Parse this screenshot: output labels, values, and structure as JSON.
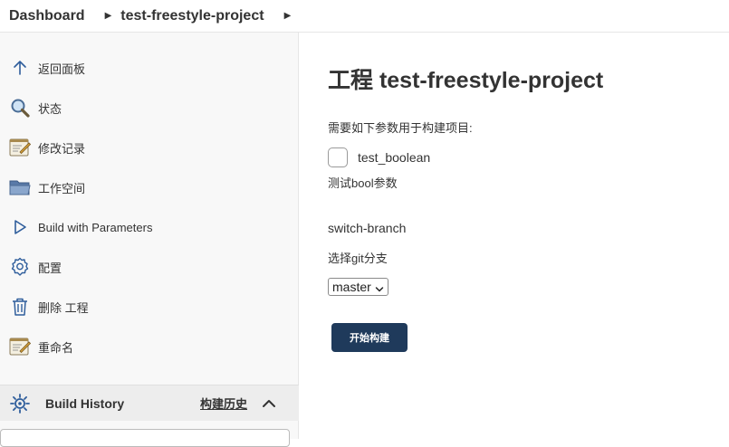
{
  "breadcrumb": {
    "home": "Dashboard",
    "project": "test-freestyle-project"
  },
  "sidebar": {
    "tasks": [
      {
        "label": "返回面板",
        "icon": "arrow-up-icon"
      },
      {
        "label": "状态",
        "icon": "magnifier-icon"
      },
      {
        "label": "修改记录",
        "icon": "notepad-icon"
      },
      {
        "label": "工作空间",
        "icon": "folder-icon"
      },
      {
        "label": "Build with Parameters",
        "icon": "play-icon"
      },
      {
        "label": "配置",
        "icon": "gear-icon"
      },
      {
        "label": "删除 工程",
        "icon": "trash-icon"
      },
      {
        "label": "重命名",
        "icon": "notepad-icon"
      }
    ],
    "build_history": {
      "title": "Build History",
      "trend": "构建历史"
    }
  },
  "main": {
    "title": "工程 test-freestyle-project",
    "intro": "需要如下参数用于构建项目:",
    "boolean_param": {
      "name": "test_boolean",
      "description": "测试bool参数",
      "checked": false
    },
    "choice_param": {
      "name": "switch-branch",
      "description": "选择git分支",
      "selected": "master"
    },
    "build_button": "开始构建"
  },
  "colors": {
    "accent": "#1f3a5b",
    "icon_blue": "#2f5e9c"
  }
}
